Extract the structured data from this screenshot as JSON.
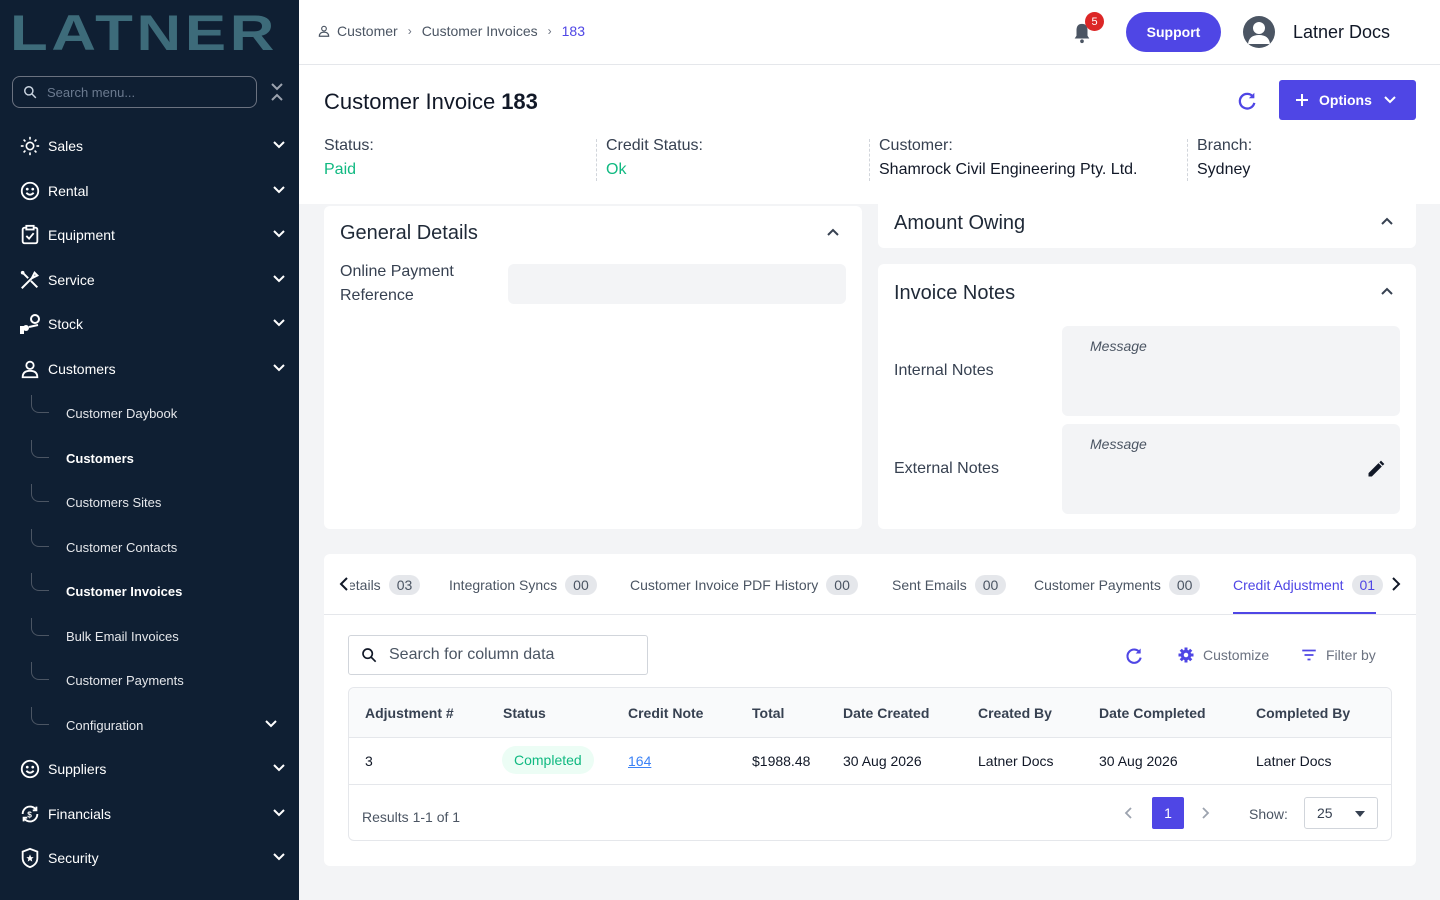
{
  "app": {
    "logo_text": "LATNER",
    "search_placeholder": "Search menu..."
  },
  "sidebar": {
    "items": [
      {
        "label": "Sales",
        "icon": "sales-icon"
      },
      {
        "label": "Rental",
        "icon": "rental-icon"
      },
      {
        "label": "Equipment",
        "icon": "equipment-icon"
      },
      {
        "label": "Service",
        "icon": "service-icon"
      },
      {
        "label": "Stock",
        "icon": "stock-icon"
      },
      {
        "label": "Customers",
        "icon": "user-icon"
      },
      {
        "label": "Suppliers",
        "icon": "suppliers-icon"
      },
      {
        "label": "Financials",
        "icon": "financials-icon"
      },
      {
        "label": "Security",
        "icon": "shield-icon"
      }
    ],
    "customers_sub": [
      {
        "label": "Customer Daybook",
        "bold": false
      },
      {
        "label": "Customers",
        "bold": true
      },
      {
        "label": "Customers Sites",
        "bold": false
      },
      {
        "label": "Customer Contacts",
        "bold": false
      },
      {
        "label": "Customer Invoices",
        "bold": true
      },
      {
        "label": "Bulk Email Invoices",
        "bold": false
      },
      {
        "label": "Customer Payments",
        "bold": false
      },
      {
        "label": "Configuration",
        "bold": false
      }
    ]
  },
  "topbar": {
    "breadcrumbs": [
      "Customer",
      "Customer Invoices",
      "183"
    ],
    "notification_count": "5",
    "support_label": "Support",
    "user_name": "Latner Docs"
  },
  "header": {
    "title": "Customer Invoice",
    "number": "183",
    "options_label": "Options",
    "meta": [
      {
        "label": "Status:",
        "value": "Paid",
        "color": "green"
      },
      {
        "label": "Credit Status:",
        "value": "Ok",
        "color": "green"
      },
      {
        "label": "Customer:",
        "value": "Shamrock Civil Engineering Pty. Ltd.",
        "color": "dark"
      },
      {
        "label": "Branch:",
        "value": "Sydney",
        "color": "dark"
      }
    ]
  },
  "general": {
    "title": "General Details",
    "online_payment_label_1": "Online Payment",
    "online_payment_label_2": "Reference"
  },
  "amount": {
    "title": "Amount Owing"
  },
  "notes": {
    "title": "Invoice Notes",
    "internal_label": "Internal Notes",
    "external_label": "External Notes",
    "message_placeholder": "Message"
  },
  "tabs": [
    {
      "label": "etails",
      "count": "03",
      "active": false
    },
    {
      "label": "Integration Syncs",
      "count": "00",
      "active": false
    },
    {
      "label": "Customer Invoice PDF History",
      "count": "00",
      "active": false
    },
    {
      "label": "Sent Emails",
      "count": "00",
      "active": false
    },
    {
      "label": "Customer Payments",
      "count": "00",
      "active": false
    },
    {
      "label": "Credit Adjustment",
      "count": "01",
      "active": true
    }
  ],
  "table": {
    "search_placeholder": "Search for column data",
    "customize_label": "Customize",
    "filter_label": "Filter by",
    "columns": [
      "Adjustment #",
      "Status",
      "Credit Note",
      "Total",
      "Date Created",
      "Created By",
      "Date Completed",
      "Completed By"
    ],
    "rows": [
      {
        "adjustment": "3",
        "status": "Completed",
        "credit_note": "164",
        "total": "$1988.48",
        "date_created": "30 Aug 2026",
        "created_by": "Latner Docs",
        "date_completed": "30 Aug 2026",
        "completed_by": "Latner Docs"
      }
    ],
    "results_text": "Results 1-1 of 1",
    "current_page": "1",
    "show_label": "Show:",
    "page_size": "25"
  },
  "colors": {
    "accent": "#4f46e5",
    "sidebar": "#0f1f33",
    "success": "#10b981",
    "logo": "#3d6b7a"
  }
}
